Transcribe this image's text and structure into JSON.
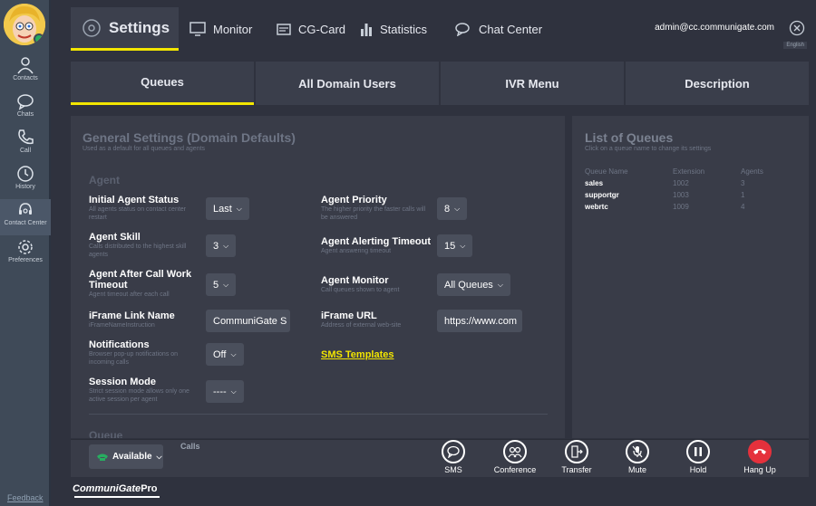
{
  "sidebar": {
    "items": [
      {
        "label": "Contacts",
        "icon": "person-icon"
      },
      {
        "label": "Chats",
        "icon": "chat-bubble-icon"
      },
      {
        "label": "Call",
        "icon": "phone-icon"
      },
      {
        "label": "History",
        "icon": "clock-icon"
      },
      {
        "label": "Contact Center",
        "icon": "headset-icon"
      },
      {
        "label": "Preferences",
        "icon": "gear-icon"
      }
    ],
    "feedback": "Feedback"
  },
  "topbar": {
    "tabs": [
      "Settings",
      "Monitor",
      "CG-Card",
      "Statistics",
      "Chat Center"
    ],
    "user": "admin@cc.communigate.com",
    "lang": "English"
  },
  "subtabs": [
    "Queues",
    "All Domain Users",
    "IVR Menu",
    "Description"
  ],
  "general": {
    "title": "General Settings (Domain Defaults)",
    "subtitle": "Used as a default for all queues and agents",
    "agent_heading": "Agent",
    "queue_heading": "Queue",
    "initial_status": {
      "label": "Initial Agent Status",
      "desc": "All agents status on contact center restart",
      "value": "Last"
    },
    "skill": {
      "label": "Agent Skill",
      "desc": "Calls distributed to the highest skill agents",
      "value": "3"
    },
    "after_call": {
      "label": "Agent After Call Work Timeout",
      "desc": "Agent timeout after each call",
      "value": "5"
    },
    "iframe_name": {
      "label": "iFrame Link Name",
      "desc": "iFrameNameInstruction",
      "value": "CommuniGate S"
    },
    "notifications": {
      "label": "Notifications",
      "desc": "Browser pop-up notifications on incoming calls",
      "value": "Off"
    },
    "session_mode": {
      "label": "Session Mode",
      "desc": "Strict session mode allows only one active session per agent",
      "value": "----"
    },
    "priority": {
      "label": "Agent Priority",
      "desc": "The higher priority the faster calls will be answered",
      "value": "8"
    },
    "alerting": {
      "label": "Agent Alerting Timeout",
      "desc": "Agent answering timeout",
      "value": "15"
    },
    "monitor": {
      "label": "Agent Monitor",
      "desc": "Call queues shown to agent",
      "value": "All Queues"
    },
    "iframe_url": {
      "label": "iFrame URL",
      "desc": "Address of external web-site",
      "value": "https://www.com"
    },
    "sms_templates": "SMS Templates"
  },
  "queues": {
    "title": "List of Queues",
    "subtitle": "Click on a queue name to change its settings",
    "columns": [
      "Queue Name",
      "Extension",
      "Agents"
    ],
    "rows": [
      [
        "sales",
        "1002",
        "3"
      ],
      [
        "supportgr",
        "1003",
        "1"
      ],
      [
        "webrtc",
        "1009",
        "4"
      ]
    ]
  },
  "bottom": {
    "status": "Available",
    "calls_label": "Calls",
    "actions": [
      "SMS",
      "Conference",
      "Transfer",
      "Mute",
      "Hold",
      "Hang Up"
    ]
  },
  "logo": {
    "main": "CommuniGate",
    "pro": "Pro"
  },
  "colors": {
    "accent": "#f3e600",
    "available": "#27ae60",
    "hangup": "#e5313c"
  }
}
